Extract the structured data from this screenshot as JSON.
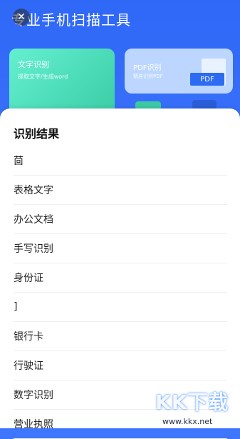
{
  "app": {
    "title": "专业手机扫描工具"
  },
  "cards": {
    "text_recognition": {
      "title": "文字识别",
      "subtitle": "提取文字/生成word"
    },
    "pdf_recognition": {
      "title": "PDF识别",
      "subtitle": "精准识别PDF",
      "badge": "PDF"
    }
  },
  "sheet": {
    "title": "识别结果",
    "items": [
      {
        "label": "茴"
      },
      {
        "label": "表格文字"
      },
      {
        "label": "办公文档"
      },
      {
        "label": "手写识别"
      },
      {
        "label": "身份证"
      },
      {
        "label": "]"
      },
      {
        "label": "银行卡"
      },
      {
        "label": "行驶证"
      },
      {
        "label": "数字识别"
      },
      {
        "label": "营业执照"
      }
    ]
  },
  "watermark": {
    "logo": "KK下载",
    "url": "www.kkx.net"
  },
  "colors": {
    "accent": "#2f67f7",
    "card_green": "#39cba4",
    "card_blue": "#bcd6ff"
  }
}
